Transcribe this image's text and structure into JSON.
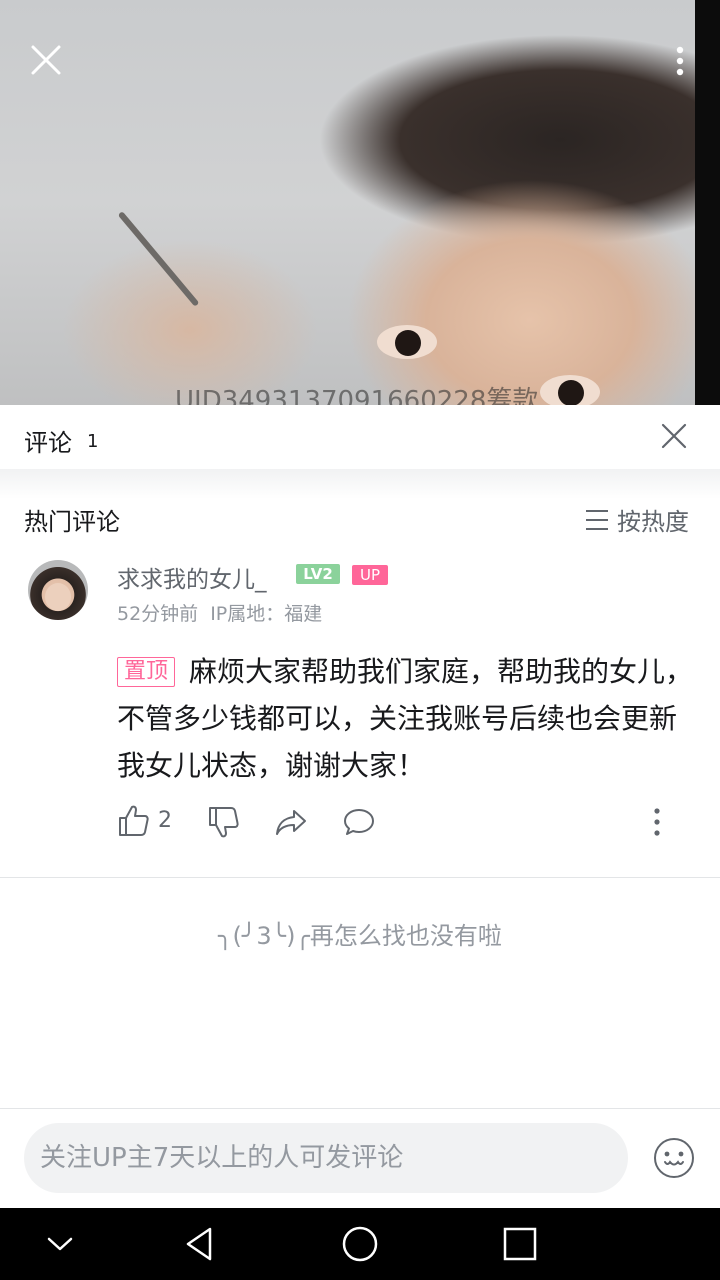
{
  "video": {
    "watermark": "UID3493137091660228筹款",
    "close_icon": "close-icon",
    "more_icon": "more-vertical-icon"
  },
  "panel": {
    "title": "评论",
    "count": "1",
    "close_icon": "close-icon"
  },
  "hot": {
    "title": "热门评论",
    "sort_label": "按热度",
    "sort_icon": "menu-lines-icon"
  },
  "comment": {
    "username": "求求我的女儿_",
    "level_badge": "LV2",
    "up_badge": "UP",
    "time": "52分钟前",
    "ip": "IP属地：福建",
    "pin_tag": "置顶",
    "text": "麻烦大家帮助我们家庭，帮助我的女儿，不管多少钱都可以，关注我账号后续也会更新我女儿状态，谢谢大家！",
    "like_count": "2"
  },
  "end_tip": "╮(╯3╰)╭再怎么找也没有啦",
  "input": {
    "placeholder": "关注UP主7天以上的人可发评论",
    "emoji_icon": "emoji-smile-icon"
  },
  "colors": {
    "accent_pink": "#ff6699",
    "level_green": "#8bd29b",
    "muted_text": "#9499a0",
    "secondary_text": "#61666d"
  }
}
